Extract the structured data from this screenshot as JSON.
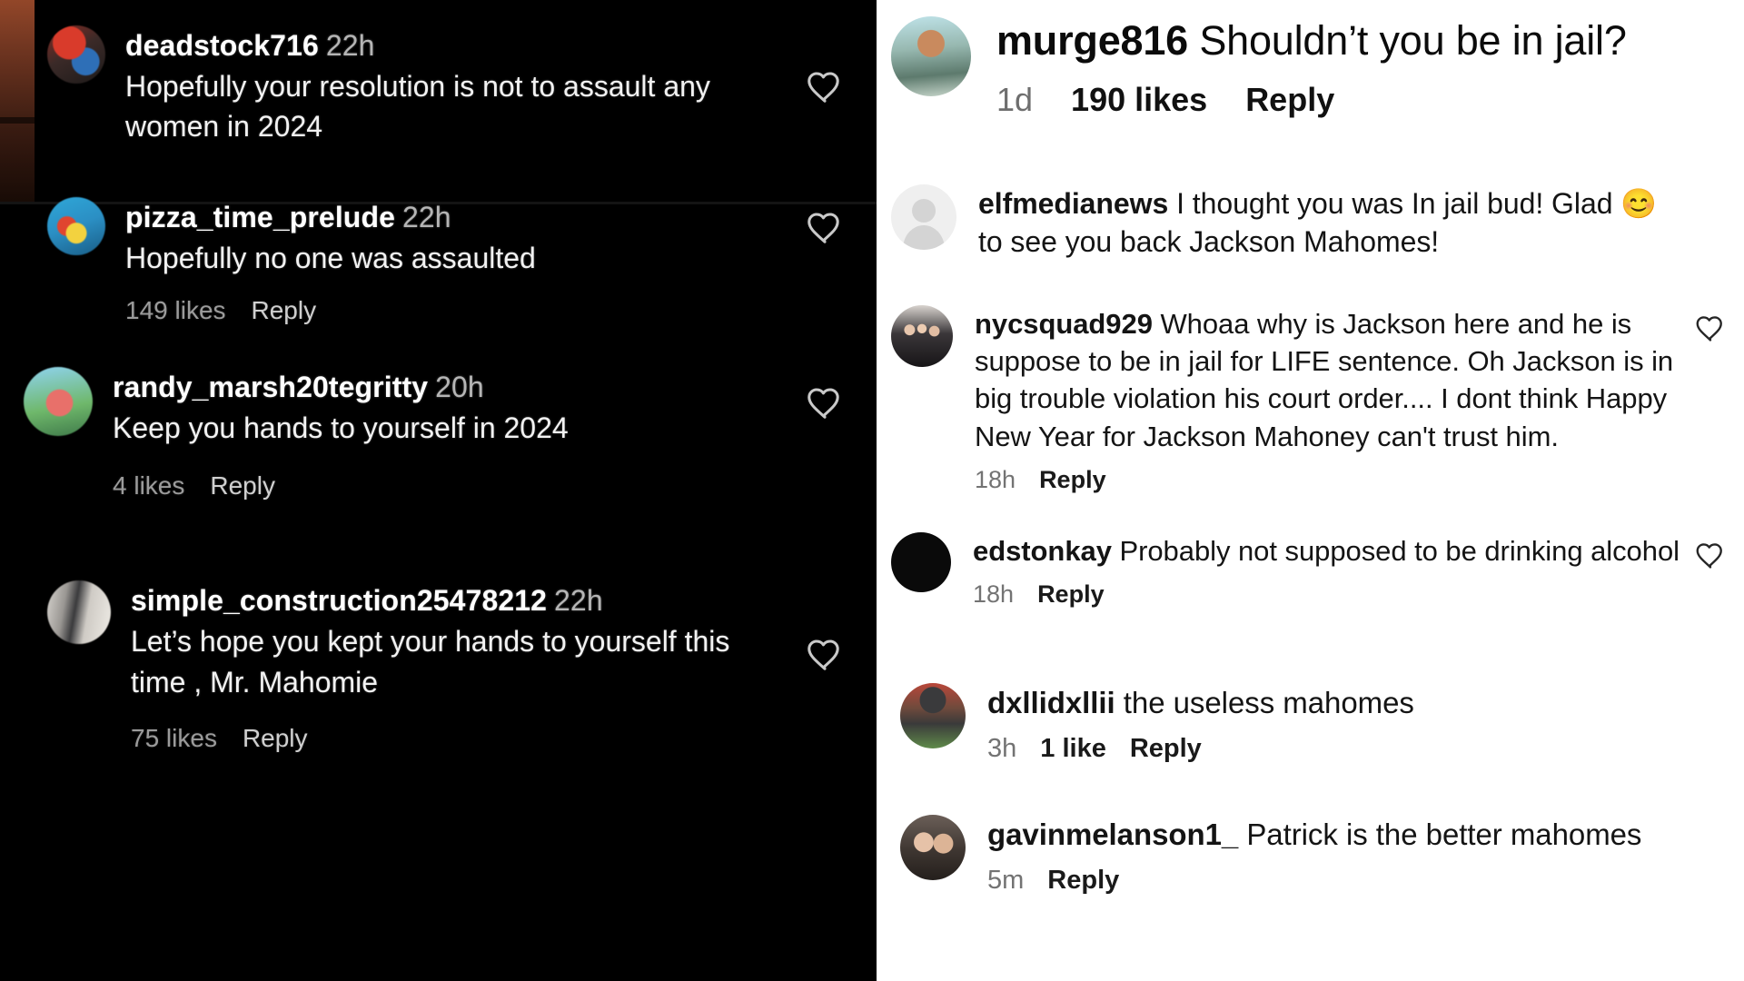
{
  "left_panel": {
    "comments": [
      {
        "username": "deadstock716",
        "time": "22h",
        "text": "Hopefully your resolution is not to assault any women in 2024",
        "likes": "",
        "reply_label": "",
        "has_heart": true,
        "avatar": "av-dead"
      },
      {
        "username": "pizza_time_prelude",
        "time": "22h",
        "text": "Hopefully no one was assaulted",
        "likes": "149 likes",
        "reply_label": "Reply",
        "has_heart": true,
        "avatar": "av-pizza"
      },
      {
        "username": "randy_marsh20tegritty",
        "time": "20h",
        "text": "Keep you hands to yourself in 2024",
        "likes": "4 likes",
        "reply_label": "Reply",
        "has_heart": true,
        "avatar": "av-randy"
      },
      {
        "username": "simple_construction25478212",
        "time": "22h",
        "text": "Let’s hope you kept your hands to yourself this time , Mr. Mahomie",
        "likes": "75 likes",
        "reply_label": "Reply",
        "has_heart": true,
        "avatar": "av-simple"
      }
    ],
    "icons": {
      "heart": "heart-icon"
    }
  },
  "right_panel": {
    "featured_comment": {
      "username": "murge816",
      "text": "Shouldn’t you be in jail?",
      "time": "1d",
      "likes": "190 likes",
      "reply_label": "Reply",
      "avatar": "av-murge"
    },
    "comments": [
      {
        "username": "elfmedianews",
        "text": "I thought you was In jail bud! Glad 😊 to see you back Jackson Mahomes!",
        "time": "",
        "likes": "",
        "reply_label": "",
        "has_heart": false,
        "avatar": "av-anon"
      },
      {
        "username": "nycsquad929",
        "text": "Whoaa why is Jackson here and he is suppose to be in jail for LIFE sentence. Oh Jackson is in big trouble violation his court order.... I dont think Happy New Year for Jackson Mahoney can't trust him.",
        "time": "18h",
        "likes": "",
        "reply_label": "Reply",
        "has_heart": true,
        "avatar": "av-nyc"
      },
      {
        "username": "edstonkay",
        "text": "Probably not supposed to be drinking alcohol",
        "time": "18h",
        "likes": "",
        "reply_label": "Reply",
        "has_heart": true,
        "avatar": "av-eds"
      },
      {
        "username": "dxllidxllii",
        "text": "the useless mahomes",
        "time": "3h",
        "likes": "1 like",
        "reply_label": "Reply",
        "has_heart": false,
        "avatar": "av-dxl"
      },
      {
        "username": "gavinmelanson1_",
        "text": "Patrick is the better mahomes",
        "time": "5m",
        "likes": "",
        "reply_label": "Reply",
        "has_heart": false,
        "avatar": "av-gav"
      }
    ],
    "icons": {
      "heart": "heart-icon",
      "anonymous_avatar": "person-placeholder-icon"
    }
  },
  "colors": {
    "dark_bg": "#000000",
    "light_bg": "#ffffff",
    "dark_text": "#ffffff",
    "muted_dark": "#9b9b9b",
    "muted_light": "#737373",
    "body_text": "#141414"
  }
}
